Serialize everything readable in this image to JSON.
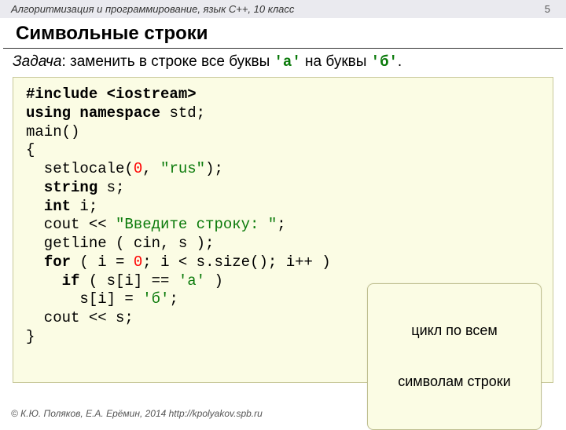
{
  "header": {
    "course": "Алгоритмизация и программирование, язык C++, 10 класс",
    "page": "5"
  },
  "title": "Символьные строки",
  "task": {
    "label": "Задача",
    "text_before": ": заменить в строке все буквы ",
    "q_a": "'а'",
    "text_mid": " на буквы ",
    "q_b": "'б'",
    "text_after": "."
  },
  "code": {
    "line1": "#include <iostream>",
    "line2a": "using",
    "line2b": " ",
    "line2c": "namespace",
    "line2d": " std;",
    "line3": "main()",
    "line4": "{",
    "line5a": "  setlocale(",
    "line5b": "0",
    "line5c": ", ",
    "line5d": "\"rus\"",
    "line5e": ");",
    "line6a": "  ",
    "line6b": "string",
    "line6c": " s;",
    "line7a": "  ",
    "line7b": "int",
    "line7c": " i;",
    "line8a": "  cout << ",
    "line8b": "\"Введите строку: \"",
    "line8c": ";",
    "line9": "  getline ( cin, s );",
    "line10a": "  ",
    "line10b": "for",
    "line10c": " ( i = ",
    "line10d": "0",
    "line10e": "; i < s.size(); i++ )",
    "line11a": "    ",
    "line11b": "if",
    "line11c": " ( s[i] == ",
    "line11d": "'а'",
    "line11e": " )",
    "line12a": "      s[i] = ",
    "line12b": "'б'",
    "line12c": ";",
    "line13": "  cout << s;",
    "line14": "}"
  },
  "callout": {
    "line1": "цикл по всем",
    "line2": "символам строки"
  },
  "footer": "© К.Ю. Поляков, Е.А. Ерёмин, 2014   http://kpolyakov.spb.ru"
}
